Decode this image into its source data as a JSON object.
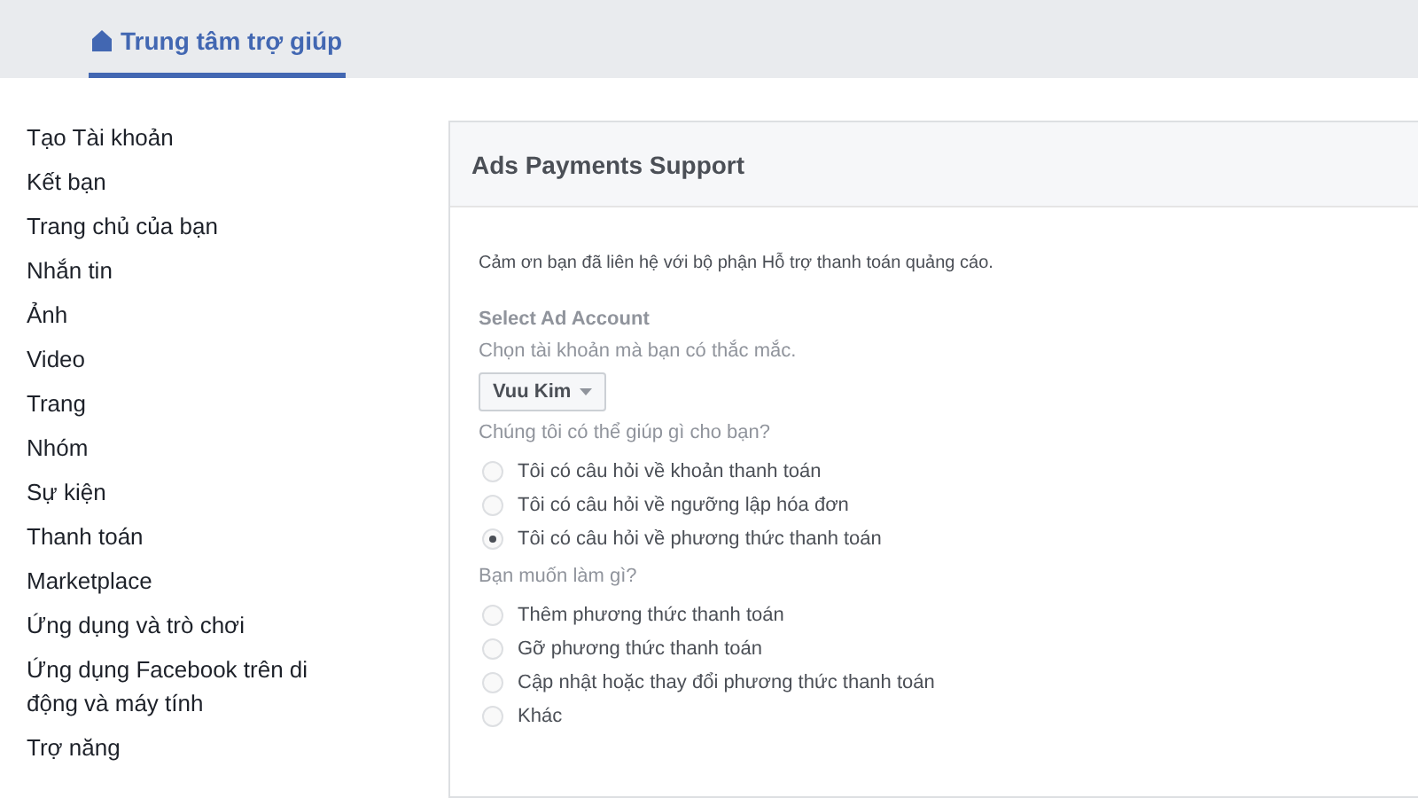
{
  "header": {
    "tab": {
      "label": "Trung tâm trợ giúp",
      "selected": true
    }
  },
  "sidebar": {
    "items": [
      "Tạo Tài khoản",
      "Kết bạn",
      "Trang chủ của bạn",
      "Nhắn tin",
      "Ảnh",
      "Video",
      "Trang",
      "Nhóm",
      "Sự kiện",
      "Thanh toán",
      "Marketplace",
      "Ứng dụng và trò chơi",
      "Ứng dụng Facebook trên di động và máy tính",
      "Trợ năng"
    ]
  },
  "panel": {
    "title": "Ads Payments Support",
    "intro": "Cảm ơn bạn đã liên hệ với bộ phận Hỗ trợ thanh toán quảng cáo.",
    "account_label": "Select Ad Account",
    "account_hint": "Chọn tài khoản mà bạn có thắc mắc.",
    "account_value": "Vuu Kim",
    "question_1": {
      "label": "Chúng tôi có thể giúp gì cho bạn?",
      "options": [
        {
          "label": "Tôi có câu hỏi về khoản thanh toán",
          "selected": false
        },
        {
          "label": "Tôi có câu hỏi về ngưỡng lập hóa đơn",
          "selected": false
        },
        {
          "label": "Tôi có câu hỏi về phương thức thanh toán",
          "selected": true
        }
      ]
    },
    "question_2": {
      "label": "Bạn muốn làm gì?",
      "options": [
        {
          "label": "Thêm phương thức thanh toán",
          "selected": false
        },
        {
          "label": "Gỡ phương thức thanh toán",
          "selected": false
        },
        {
          "label": "Cập nhật hoặc thay đổi phương thức thanh toán",
          "selected": false
        },
        {
          "label": "Khác",
          "selected": false
        }
      ]
    }
  }
}
